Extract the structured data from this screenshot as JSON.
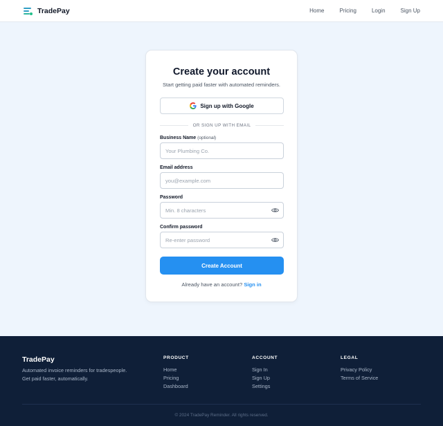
{
  "header": {
    "brand": "TradePay",
    "nav": [
      "Home",
      "Pricing",
      "Login",
      "Sign Up"
    ]
  },
  "signup": {
    "title": "Create your account",
    "subtitle": "Start getting paid faster with automated reminders.",
    "google_label": "Sign up with Google",
    "divider_text": "OR SIGN UP WITH EMAIL",
    "fields": [
      {
        "label": "Business Name",
        "optional": "(optional)",
        "placeholder": "Your Plumbing Co.",
        "value": ""
      },
      {
        "label": "Email address",
        "placeholder": "you@example.com",
        "value": ""
      },
      {
        "label": "Password",
        "placeholder": "Min. 8 characters",
        "value": ""
      },
      {
        "label": "Confirm password",
        "placeholder": "Re-enter password",
        "value": ""
      }
    ],
    "submit_label": "Create Account",
    "signin_prompt": "Already have an account?",
    "signin_link": "Sign in"
  },
  "footer": {
    "brand": "TradePay",
    "description": "Automated invoice reminders for tradespeople. Get paid faster, automatically.",
    "columns": [
      {
        "title": "PRODUCT",
        "links": [
          "Home",
          "Pricing",
          "Dashboard"
        ]
      },
      {
        "title": "ACCOUNT",
        "links": [
          "Sign In",
          "Sign Up",
          "Settings"
        ]
      },
      {
        "title": "LEGAL",
        "links": [
          "Privacy Policy",
          "Terms of Service"
        ]
      }
    ],
    "copyright": "© 2024 TradePay Reminder. All rights reserved."
  },
  "colors": {
    "primary": "#2590f1",
    "page_bg": "#eef5fd",
    "footer_bg": "#0f1f38",
    "brand_accent": "#2f9ec4"
  },
  "icons": {
    "brand": "trade-pay-logo-icon",
    "google": "google-g-icon",
    "password_toggle": "eye-icon"
  }
}
